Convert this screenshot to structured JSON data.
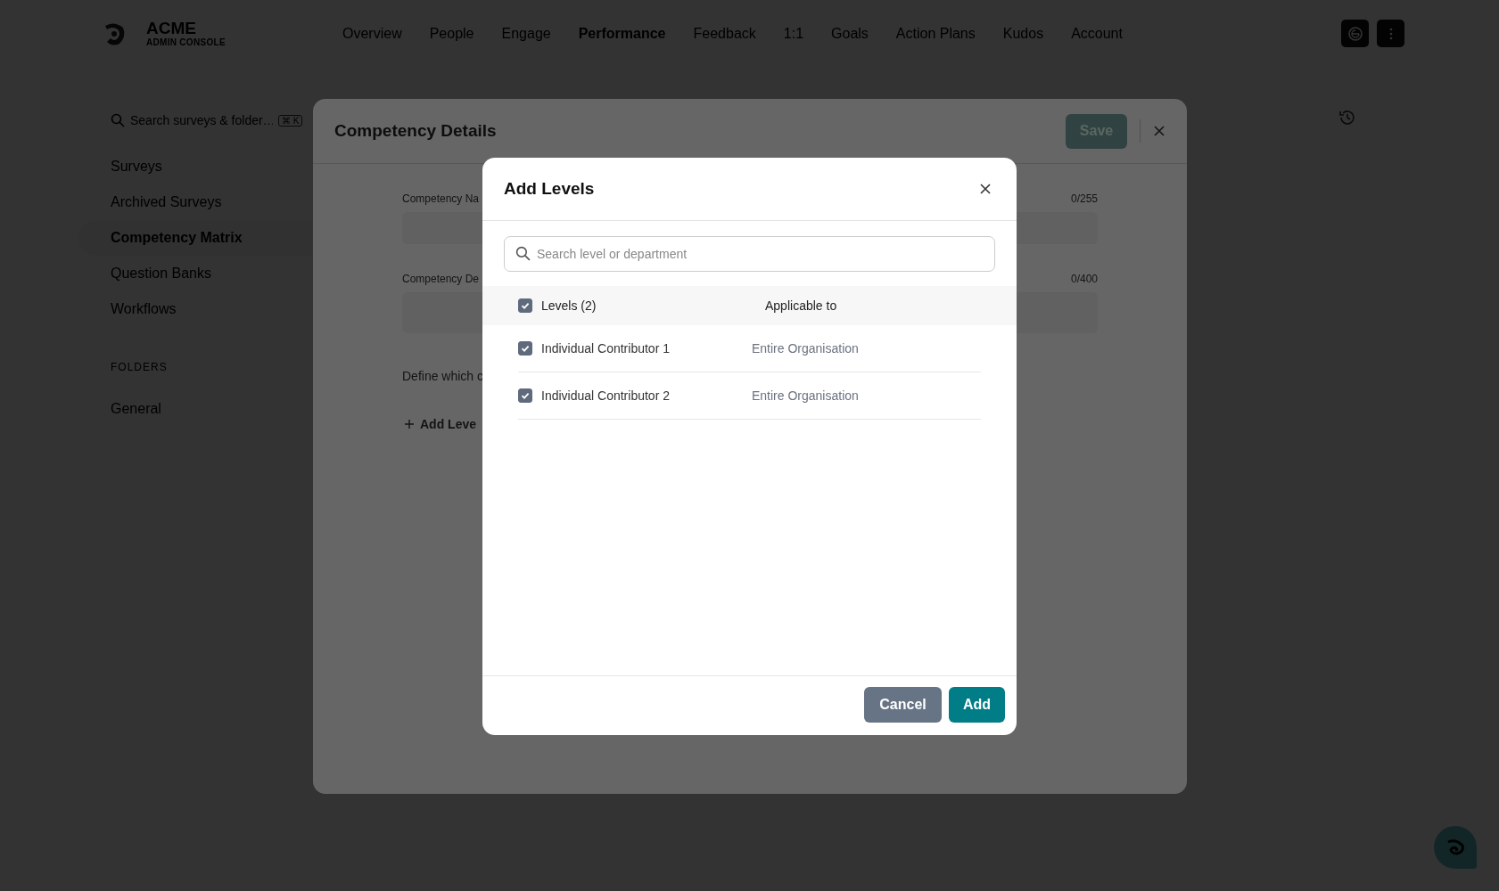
{
  "brand": {
    "title": "ACME",
    "subtitle": "ADMIN CONSOLE"
  },
  "nav": [
    {
      "label": "Overview",
      "selected": false
    },
    {
      "label": "People",
      "selected": false
    },
    {
      "label": "Engage",
      "selected": false
    },
    {
      "label": "Performance",
      "selected": true
    },
    {
      "label": "Feedback",
      "selected": false
    },
    {
      "label": "1:1",
      "selected": false
    },
    {
      "label": "Goals",
      "selected": false
    },
    {
      "label": "Action Plans",
      "selected": false
    },
    {
      "label": "Kudos",
      "selected": false
    },
    {
      "label": "Account",
      "selected": false
    }
  ],
  "sidebar": {
    "search": {
      "placeholder": "Search surveys & folder…",
      "shortcut": "⌘ K"
    },
    "items": [
      {
        "label": "Surveys",
        "selected": false
      },
      {
        "label": "Archived Surveys",
        "selected": false
      },
      {
        "label": "Competency Matrix",
        "selected": true
      },
      {
        "label": "Question Banks",
        "selected": false
      },
      {
        "label": "Workflows",
        "selected": false
      }
    ],
    "section_title": "FOLDERS",
    "folders": [
      {
        "label": "General"
      }
    ]
  },
  "panel": {
    "title": "Competency Details",
    "save": "Save",
    "fields": [
      {
        "label": "Competency Na",
        "counter": "0/255",
        "kind": "short"
      },
      {
        "label": "Competency De",
        "counter": "0/400",
        "kind": "long"
      }
    ],
    "define_text": "Define which c",
    "add_link": "Add Leve"
  },
  "modal": {
    "title": "Add Levels",
    "search": {
      "placeholder": "Search level or department"
    },
    "header": {
      "label": "Levels (2)",
      "checked": true,
      "column_2": "Applicable to"
    },
    "rows": [
      {
        "name": "Individual Contributor 1",
        "applicable": "Entire Organisation",
        "checked": true
      },
      {
        "name": "Individual Contributor 2",
        "applicable": "Entire Organisation",
        "checked": true
      }
    ],
    "cancel": "Cancel",
    "add": "Add"
  }
}
